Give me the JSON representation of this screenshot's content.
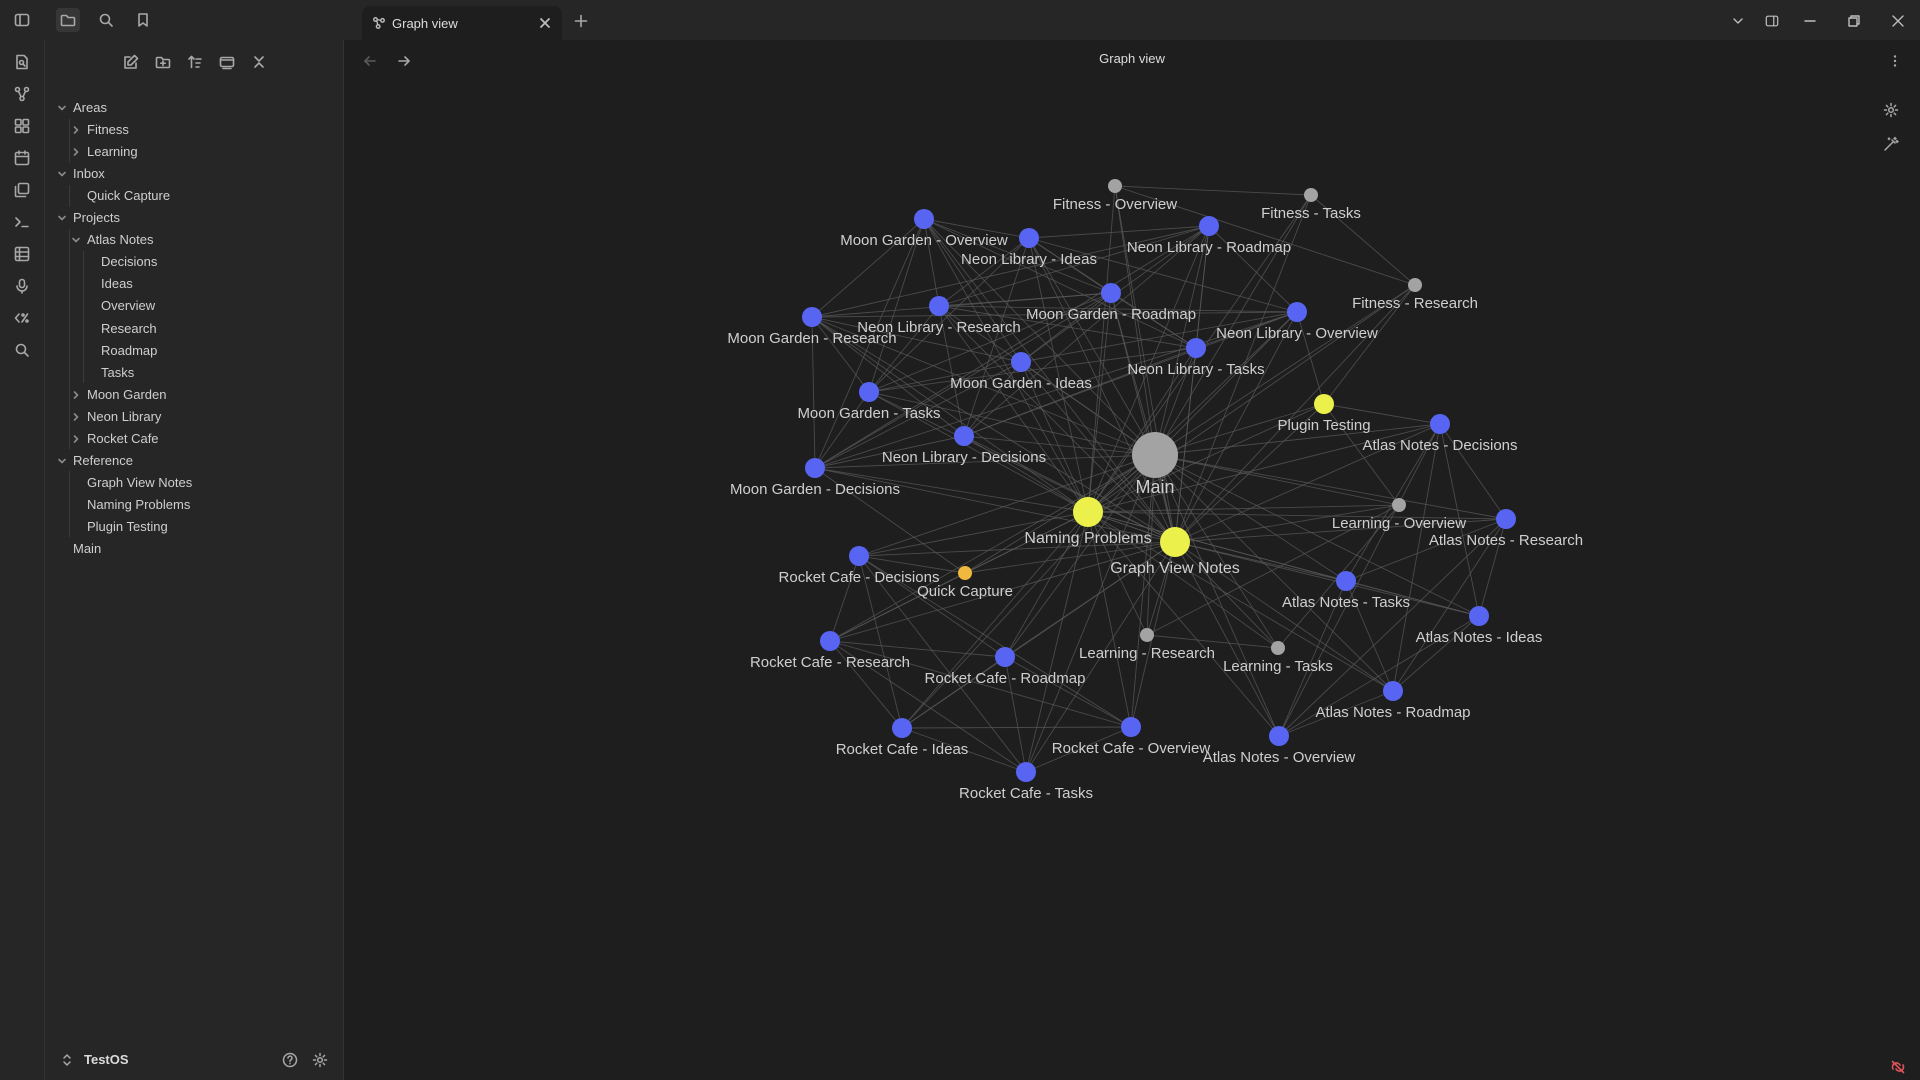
{
  "tab": {
    "label": "Graph view"
  },
  "view": {
    "title": "Graph view"
  },
  "sidebar": {
    "vault_name": "TestOS",
    "tree": [
      {
        "label": "Areas",
        "depth": 0,
        "folder": true,
        "expanded": true
      },
      {
        "label": "Fitness",
        "depth": 1,
        "folder": true,
        "expanded": false
      },
      {
        "label": "Learning",
        "depth": 1,
        "folder": true,
        "expanded": false
      },
      {
        "label": "Inbox",
        "depth": 0,
        "folder": true,
        "expanded": true
      },
      {
        "label": "Quick Capture",
        "depth": 1,
        "folder": false
      },
      {
        "label": "Projects",
        "depth": 0,
        "folder": true,
        "expanded": true
      },
      {
        "label": "Atlas Notes",
        "depth": 1,
        "folder": true,
        "expanded": true
      },
      {
        "label": "Decisions",
        "depth": 2,
        "folder": false
      },
      {
        "label": "Ideas",
        "depth": 2,
        "folder": false
      },
      {
        "label": "Overview",
        "depth": 2,
        "folder": false
      },
      {
        "label": "Research",
        "depth": 2,
        "folder": false
      },
      {
        "label": "Roadmap",
        "depth": 2,
        "folder": false
      },
      {
        "label": "Tasks",
        "depth": 2,
        "folder": false
      },
      {
        "label": "Moon Garden",
        "depth": 1,
        "folder": true,
        "expanded": false
      },
      {
        "label": "Neon Library",
        "depth": 1,
        "folder": true,
        "expanded": false
      },
      {
        "label": "Rocket Cafe",
        "depth": 1,
        "folder": true,
        "expanded": false
      },
      {
        "label": "Reference",
        "depth": 0,
        "folder": true,
        "expanded": true
      },
      {
        "label": "Graph View Notes",
        "depth": 1,
        "folder": false
      },
      {
        "label": "Naming Problems",
        "depth": 1,
        "folder": false
      },
      {
        "label": "Plugin Testing",
        "depth": 1,
        "folder": false
      },
      {
        "label": "Main",
        "depth": 0,
        "folder": false
      }
    ]
  },
  "graph": {
    "colors": {
      "blue": "#5865f2",
      "yellow": "#ecf04a",
      "grey": "#a3a3a3",
      "orange": "#f0b83c",
      "edge": "#595959",
      "label": "#cfcfcf"
    },
    "nodes": [
      {
        "label": "Main",
        "color": "grey",
        "size": "large"
      },
      {
        "label": "Naming Problems",
        "color": "yellow",
        "size": "medium"
      },
      {
        "label": "Graph View Notes",
        "color": "yellow",
        "size": "medium"
      },
      {
        "label": "Plugin Testing",
        "color": "yellow",
        "size": "small"
      },
      {
        "label": "Quick Capture",
        "color": "orange",
        "size": "tiny"
      },
      {
        "label": "Fitness - Overview",
        "color": "grey",
        "size": "tiny"
      },
      {
        "label": "Fitness - Tasks",
        "color": "grey",
        "size": "tiny"
      },
      {
        "label": "Fitness - Research",
        "color": "grey",
        "size": "tiny"
      },
      {
        "label": "Learning - Overview",
        "color": "grey",
        "size": "tiny"
      },
      {
        "label": "Learning - Research",
        "color": "grey",
        "size": "tiny"
      },
      {
        "label": "Learning - Tasks",
        "color": "grey",
        "size": "tiny"
      },
      {
        "label": "Moon Garden - Overview",
        "color": "blue",
        "size": "small"
      },
      {
        "label": "Neon Library - Ideas",
        "color": "blue",
        "size": "small"
      },
      {
        "label": "Neon Library - Roadmap",
        "color": "blue",
        "size": "small"
      },
      {
        "label": "Moon Garden - Research",
        "color": "blue",
        "size": "small"
      },
      {
        "label": "Neon Library - Research",
        "color": "blue",
        "size": "small"
      },
      {
        "label": "Moon Garden - Roadmap",
        "color": "blue",
        "size": "small"
      },
      {
        "label": "Neon Library - Overview",
        "color": "blue",
        "size": "small"
      },
      {
        "label": "Moon Garden - Ideas",
        "color": "blue",
        "size": "small"
      },
      {
        "label": "Neon Library - Tasks",
        "color": "blue",
        "size": "small"
      },
      {
        "label": "Moon Garden - Tasks",
        "color": "blue",
        "size": "small"
      },
      {
        "label": "Neon Library - Decisions",
        "color": "blue",
        "size": "small"
      },
      {
        "label": "Moon Garden - Decisions",
        "color": "blue",
        "size": "small"
      },
      {
        "label": "Atlas Notes - Decisions",
        "color": "blue",
        "size": "small"
      },
      {
        "label": "Atlas Notes - Research",
        "color": "blue",
        "size": "small"
      },
      {
        "label": "Atlas Notes - Tasks",
        "color": "blue",
        "size": "small"
      },
      {
        "label": "Atlas Notes - Ideas",
        "color": "blue",
        "size": "small"
      },
      {
        "label": "Atlas Notes - Roadmap",
        "color": "blue",
        "size": "small"
      },
      {
        "label": "Atlas Notes - Overview",
        "color": "blue",
        "size": "small"
      },
      {
        "label": "Rocket Cafe - Decisions",
        "color": "blue",
        "size": "small"
      },
      {
        "label": "Rocket Cafe - Research",
        "color": "blue",
        "size": "small"
      },
      {
        "label": "Rocket Cafe - Roadmap",
        "color": "blue",
        "size": "small"
      },
      {
        "label": "Rocket Cafe - Ideas",
        "color": "blue",
        "size": "small"
      },
      {
        "label": "Rocket Cafe - Overview",
        "color": "blue",
        "size": "small"
      },
      {
        "label": "Rocket Cafe - Tasks",
        "color": "blue",
        "size": "small"
      }
    ]
  }
}
